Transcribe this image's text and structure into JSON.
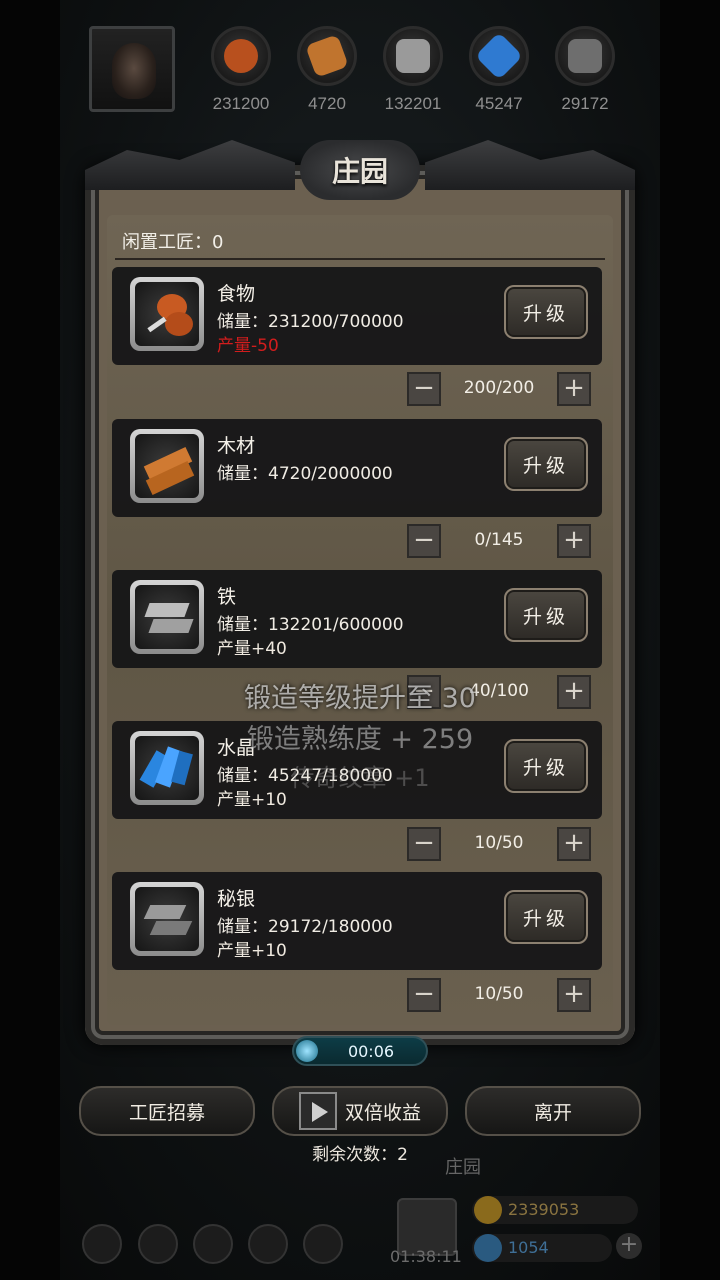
{
  "top_resources": [
    {
      "name": "food",
      "value": "231200",
      "color": "#b8501e"
    },
    {
      "name": "wood",
      "value": "4720",
      "color": "#c0742e"
    },
    {
      "name": "iron",
      "value": "132201",
      "color": "#9a9a9a"
    },
    {
      "name": "crystal",
      "value": "45247",
      "color": "#2f7ad1"
    },
    {
      "name": "mithril",
      "value": "29172",
      "color": "#6e6e6e"
    }
  ],
  "panel": {
    "title": "庄园",
    "idle_workers": "闲置工匠：0"
  },
  "rows": [
    {
      "name": "食物",
      "stock": "储量：231200/700000",
      "production": "产量-50",
      "upgrade": "升级",
      "workers": "200/200",
      "icon": "food-icon",
      "icon_color": "#c85a22"
    },
    {
      "name": "木材",
      "stock": "储量：4720/2000000",
      "production": "",
      "upgrade": "升级",
      "workers": "0/145",
      "icon": "wood-icon",
      "icon_color": "#d07a32"
    },
    {
      "name": "铁",
      "stock": "储量：132201/600000",
      "production": "产量+40",
      "upgrade": "升级",
      "workers": "40/100",
      "icon": "iron-icon",
      "icon_color": "#a8a8a8"
    },
    {
      "name": "水晶",
      "stock": "储量：45247/180000",
      "production": "产量+10",
      "upgrade": "升级",
      "workers": "10/50",
      "icon": "crystal-icon",
      "icon_color": "#2a86e0"
    },
    {
      "name": "秘银",
      "stock": "储量：29172/180000",
      "production": "产量+10",
      "upgrade": "升级",
      "workers": "10/50",
      "icon": "mithril-icon",
      "icon_color": "#8a8a8a"
    }
  ],
  "toast": {
    "line1": "锻造等级提升至 30",
    "line2": "锻造熟练度 + 259",
    "line3": "传奇纹章 +1"
  },
  "timer": "00:06",
  "buttons": {
    "recruit": "工匠招募",
    "double": "双倍收益",
    "leave": "离开"
  },
  "remaining": "剩余次数：2",
  "footer": {
    "title": "庄园",
    "clock": "01:38:11",
    "gold": "2339053",
    "gems": "1054"
  }
}
